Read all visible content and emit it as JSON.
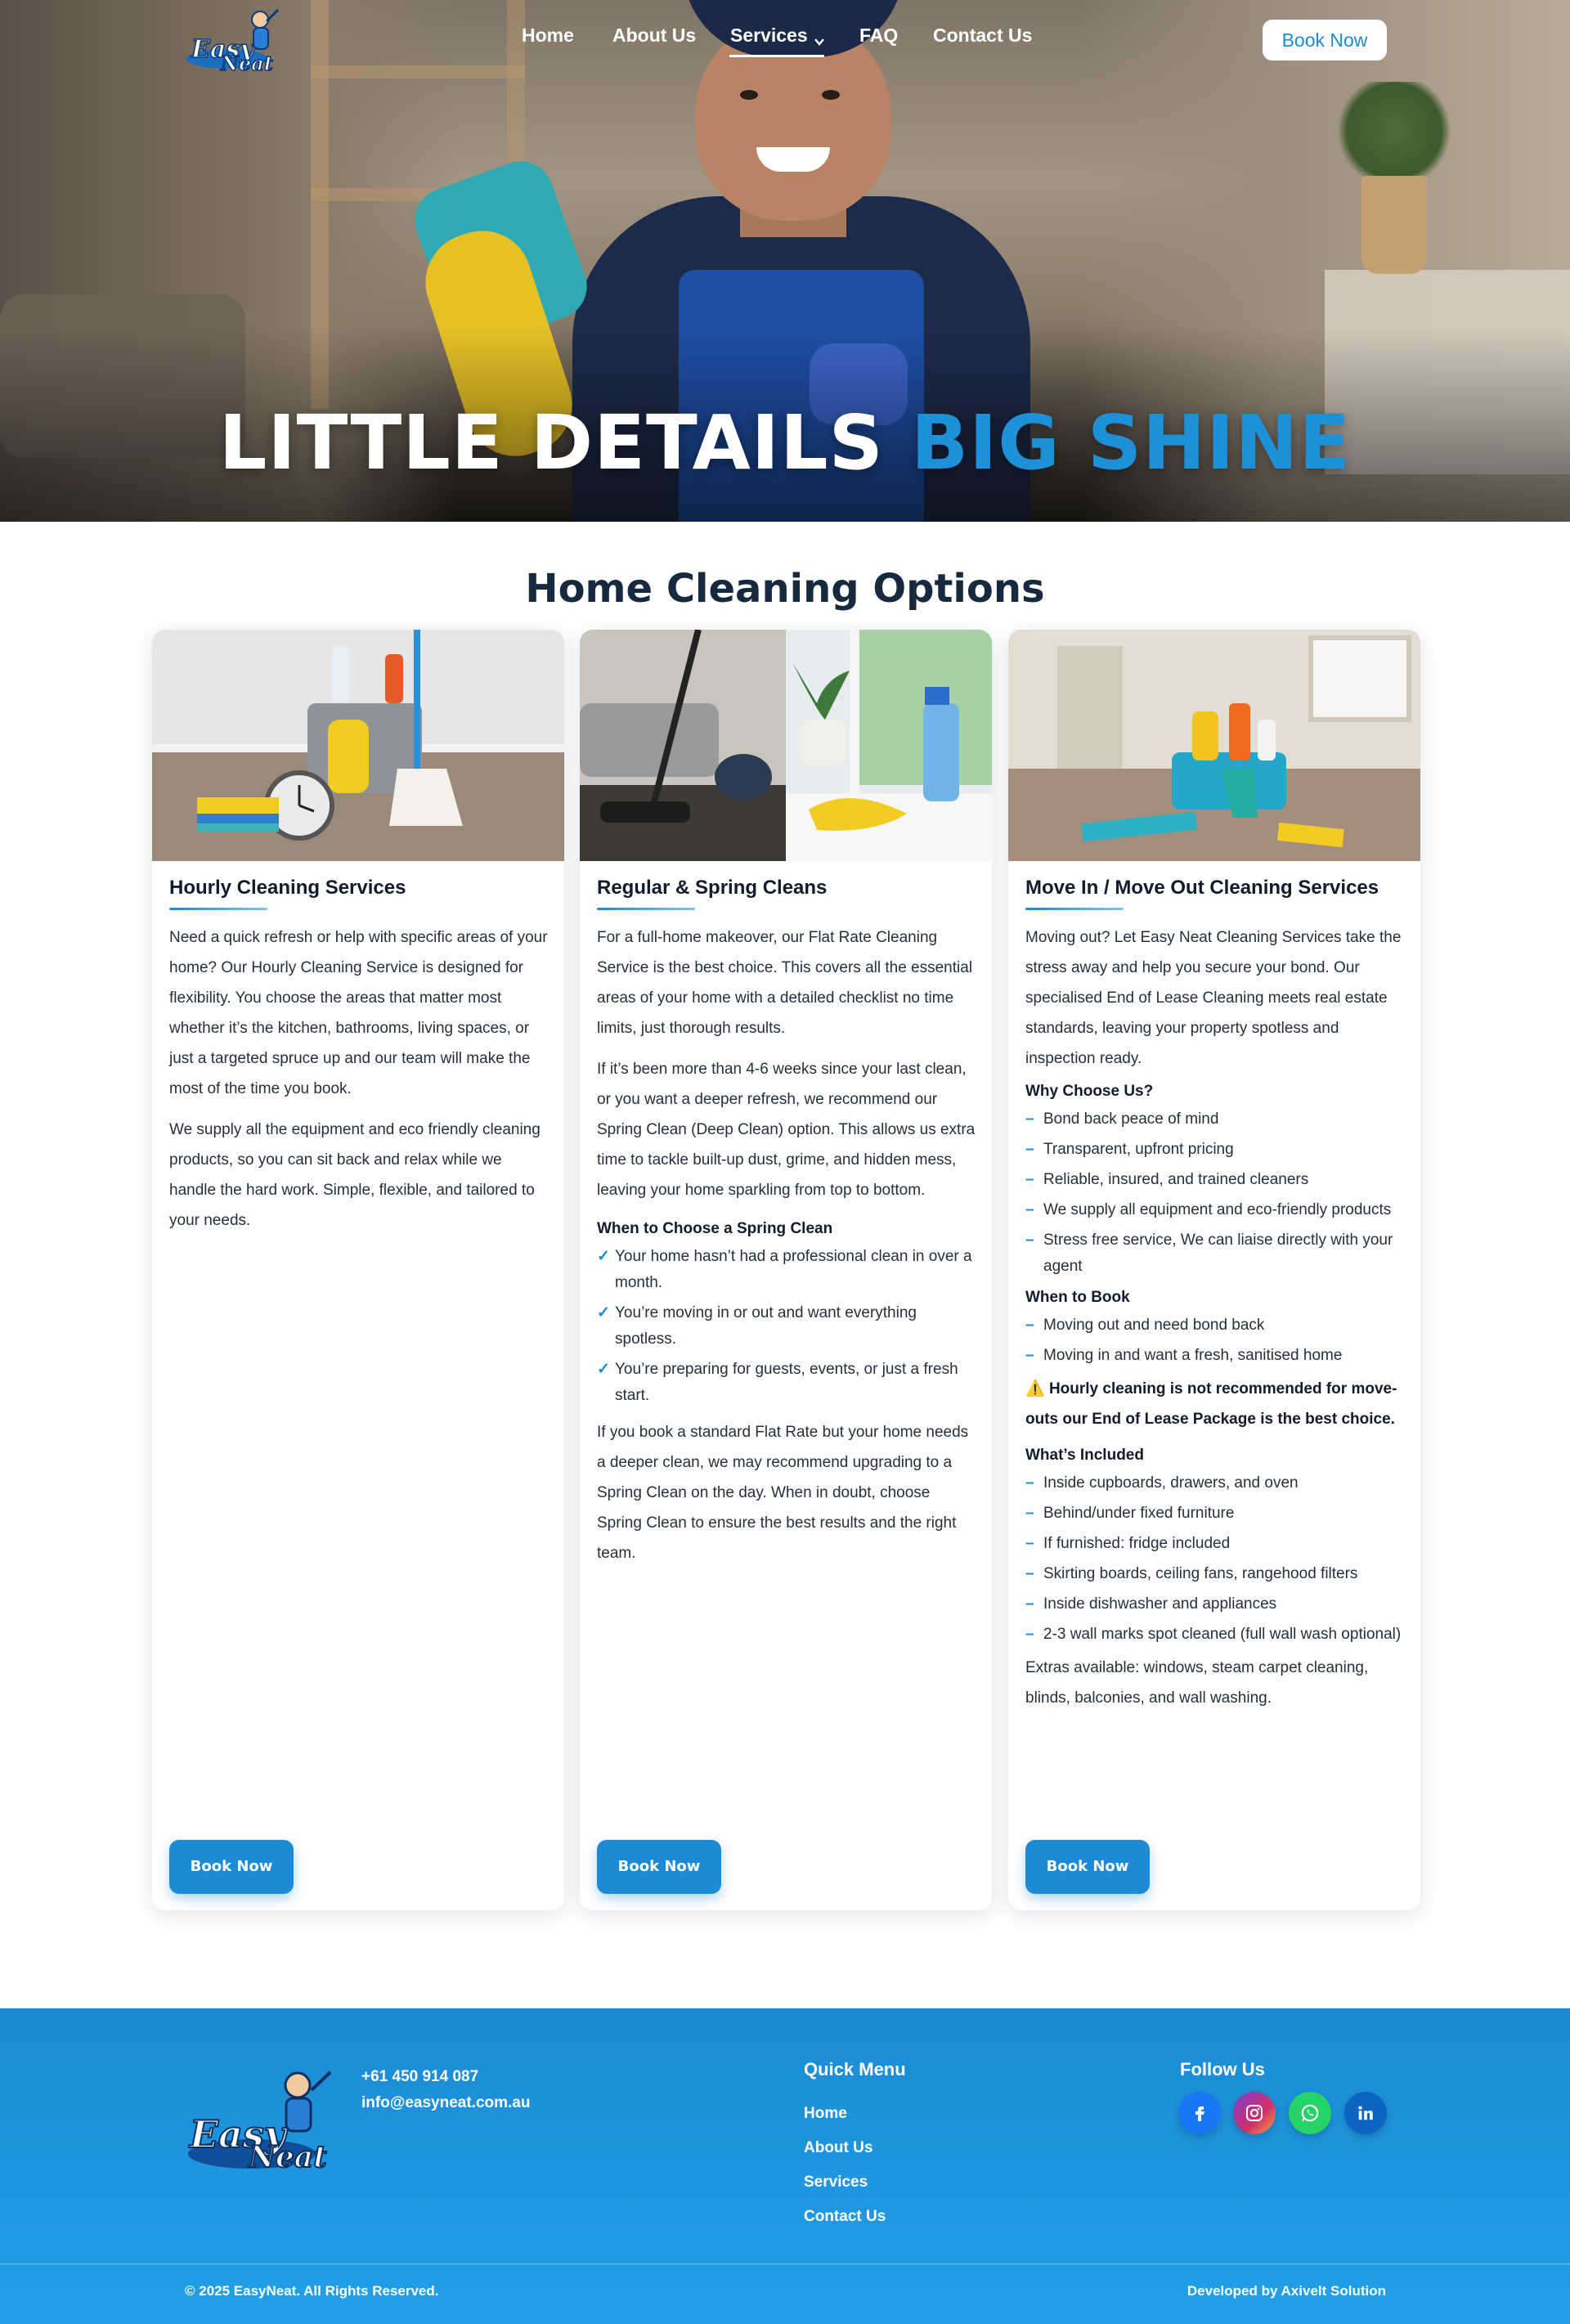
{
  "nav": {
    "logo_alt": "Easy Neat",
    "items": [
      "Home",
      "About Us",
      "Services",
      "FAQ",
      "Contact Us"
    ],
    "active": "Services",
    "book_now": "Book Now"
  },
  "hero": {
    "title_white": "LITTLE DETAILS",
    "title_blue": "BIG SHINE"
  },
  "section": {
    "title": "Home Cleaning Options"
  },
  "cards": [
    {
      "title": "Hourly Cleaning Services",
      "paragraphs": [
        "Need a quick refresh or help with specific areas of your home? Our Hourly Cleaning Service is designed for flexibility. You choose the areas that matter most whether it’s the kitchen, bathrooms, living spaces, or just a targeted spruce up and our team will make the most of the time you book.",
        "We supply all the equipment and eco friendly cleaning products, so you can sit back and relax while we handle the hard work. Simple, flexible, and tailored to your needs."
      ],
      "button": "Book Now"
    },
    {
      "title": "Regular & Spring Cleans",
      "paragraphs": [
        "For a full-home makeover, our Flat Rate Cleaning Service is the best choice. This covers all the essential areas of your home with a detailed checklist no time limits, just thorough results.",
        "If it’s been more than 4-6 weeks since your last clean, or you want a deeper refresh, we recommend our Spring Clean (Deep Clean) option. This allows us extra time to tackle built-up dust, grime, and hidden mess, leaving your home sparkling from top to bottom."
      ],
      "subheading": "When to Choose a Spring Clean",
      "checklist": [
        "Your home hasn’t had a professional clean in over a month.",
        "You’re moving in or out and want everything spotless.",
        "You’re preparing for guests, events, or just a fresh start."
      ],
      "closing": "If you book a standard Flat Rate but your home needs a deeper clean, we may recommend upgrading to a Spring Clean on the day. When in doubt, choose Spring Clean to ensure the best results and the right team.",
      "button": "Book Now"
    },
    {
      "title": "Move In / Move Out Cleaning Services",
      "intro": "Moving out? Let Easy Neat Cleaning Services take the stress away and help you secure your bond. Our specialised End of Lease Cleaning meets real estate standards, leaving your property spotless and inspection ready.",
      "why_heading": "Why Choose Us?",
      "why_items": [
        "Bond back peace of mind",
        "Transparent, upfront pricing",
        "Reliable, insured, and trained cleaners",
        "We supply all equipment and eco-friendly products",
        "Stress free service, We can liaise directly with your agent"
      ],
      "when_heading": "When to Book",
      "when_items": [
        "Moving out and need bond back",
        "Moving in and want a fresh, sanitised home"
      ],
      "warning_icon": "⚠️",
      "warning": "Hourly cleaning is not recommended for move-outs our End of Lease Package is the best choice.",
      "included_heading": "What’s Included",
      "included_items": [
        "Inside cupboards, drawers, and oven",
        "Behind/under fixed furniture",
        "If furnished: fridge included",
        "Skirting boards, ceiling fans, rangehood filters",
        "Inside dishwasher and appliances",
        "2-3 wall marks spot cleaned (full wall wash optional)"
      ],
      "extras": "Extras available: windows, steam carpet cleaning, blinds, balconies, and wall washing.",
      "button": "Book Now"
    }
  ],
  "list_markers": {
    "check": "✓",
    "dash": "–"
  },
  "footer": {
    "phone": "+61 450 914 087",
    "email": "info@easyneat.com.au",
    "quick_menu_heading": "Quick Menu",
    "quick_menu": [
      "Home",
      "About Us",
      "Services",
      "Contact Us"
    ],
    "follow_heading": "Follow Us",
    "social": [
      {
        "icon": "facebook-icon",
        "glyph": "f",
        "color": "#1877f2"
      },
      {
        "icon": "instagram-icon",
        "glyph": "◎",
        "color": "#c1358a"
      },
      {
        "icon": "whatsapp-icon",
        "glyph": "✆",
        "color": "#25d366"
      },
      {
        "icon": "linkedin-icon",
        "glyph": "in",
        "color": "#0a66c2"
      }
    ],
    "copyright": "© 2025 EasyNeat. All Rights Reserved.",
    "developer": "Developed by Axivelt Solution"
  },
  "colors": {
    "brand_blue": "#1c8ad4",
    "footer_blue": "#21a0e8",
    "heading_dark": "#16293f"
  }
}
